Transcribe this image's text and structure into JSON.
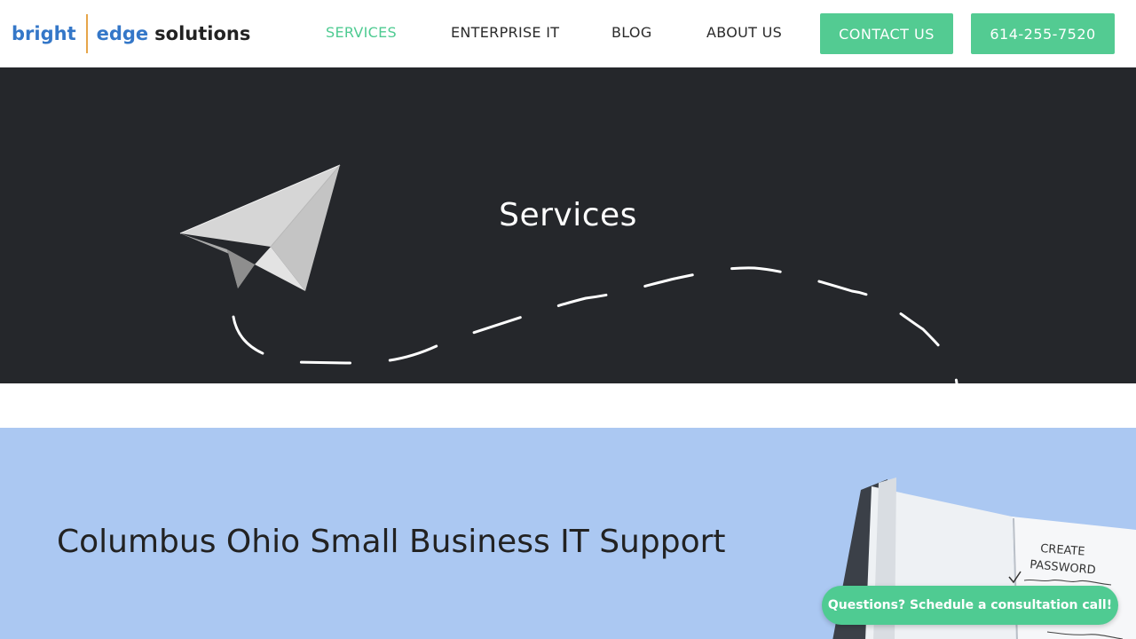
{
  "brand": {
    "part1": "bright",
    "part2": "edge",
    "part3": "solutions"
  },
  "nav": {
    "services": "SERVICES",
    "enterprise": "ENTERPRISE IT",
    "blog": "BLOG",
    "about": "ABOUT US",
    "contact": "CONTACT US",
    "phone": "614-255-7520"
  },
  "hero": {
    "title": "Services"
  },
  "section": {
    "title": "Columbus Ohio Small Business IT Support",
    "notebook_heading_line1": "CREATE",
    "notebook_heading_line2": "PASSWORD"
  },
  "chat": {
    "label": "Questions? Schedule a consultation call!"
  },
  "colors": {
    "accent_green": "#53cb92",
    "brand_blue": "#3477c8",
    "hero_bg": "#25272b",
    "section_bg": "#abc8f2"
  }
}
